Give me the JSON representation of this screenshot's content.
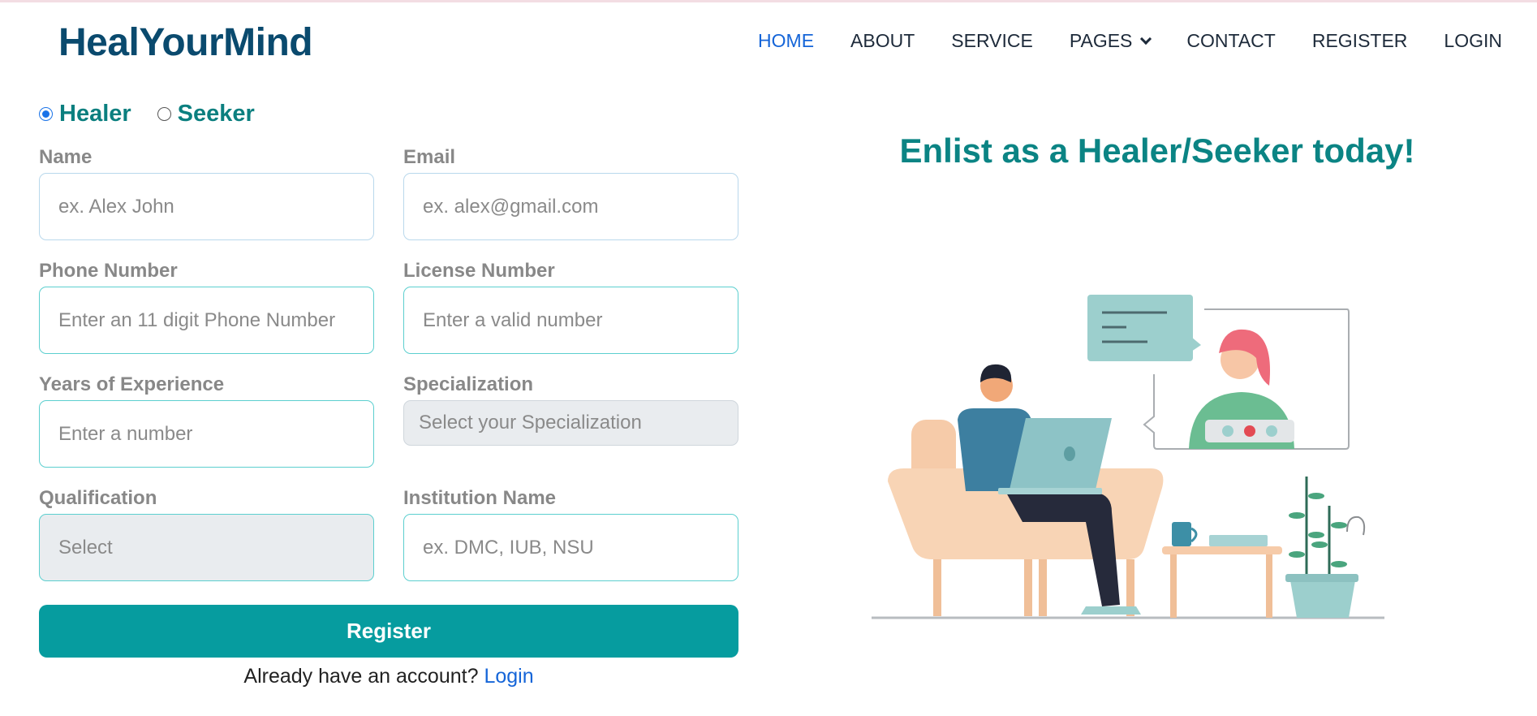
{
  "brand": "HealYourMind",
  "nav": {
    "items": [
      {
        "label": "HOME",
        "active": true
      },
      {
        "label": "ABOUT"
      },
      {
        "label": "SERVICE"
      },
      {
        "label": "PAGES",
        "dropdown": true
      },
      {
        "label": "CONTACT"
      },
      {
        "label": "REGISTER"
      },
      {
        "label": "LOGIN"
      }
    ]
  },
  "roles": {
    "selected": "Healer",
    "options": [
      "Healer",
      "Seeker"
    ]
  },
  "form": {
    "name": {
      "label": "Name",
      "placeholder": "ex. Alex John"
    },
    "email": {
      "label": "Email",
      "placeholder": "ex. alex@gmail.com"
    },
    "phone": {
      "label": "Phone Number",
      "placeholder": "Enter an 11 digit Phone Number"
    },
    "license": {
      "label": "License Number",
      "placeholder": "Enter a valid number"
    },
    "experience": {
      "label": "Years of Experience",
      "placeholder": "Enter a number"
    },
    "specialization": {
      "label": "Specialization",
      "value": "Select your Specialization"
    },
    "qualification": {
      "label": "Qualification",
      "value": "Select"
    },
    "institution": {
      "label": "Institution Name",
      "placeholder": "ex. DMC, IUB, NSU"
    },
    "submit_label": "Register",
    "login_prompt": "Already have an account?",
    "login_link": "Login"
  },
  "hero": {
    "title": "Enlist as a Healer/Seeker today!",
    "illustration": "video-call-therapy-illustration"
  },
  "colors": {
    "brand": "#0a4a6e",
    "accent": "#069c9f",
    "heading_teal": "#0b8484",
    "link": "#1565d8"
  }
}
